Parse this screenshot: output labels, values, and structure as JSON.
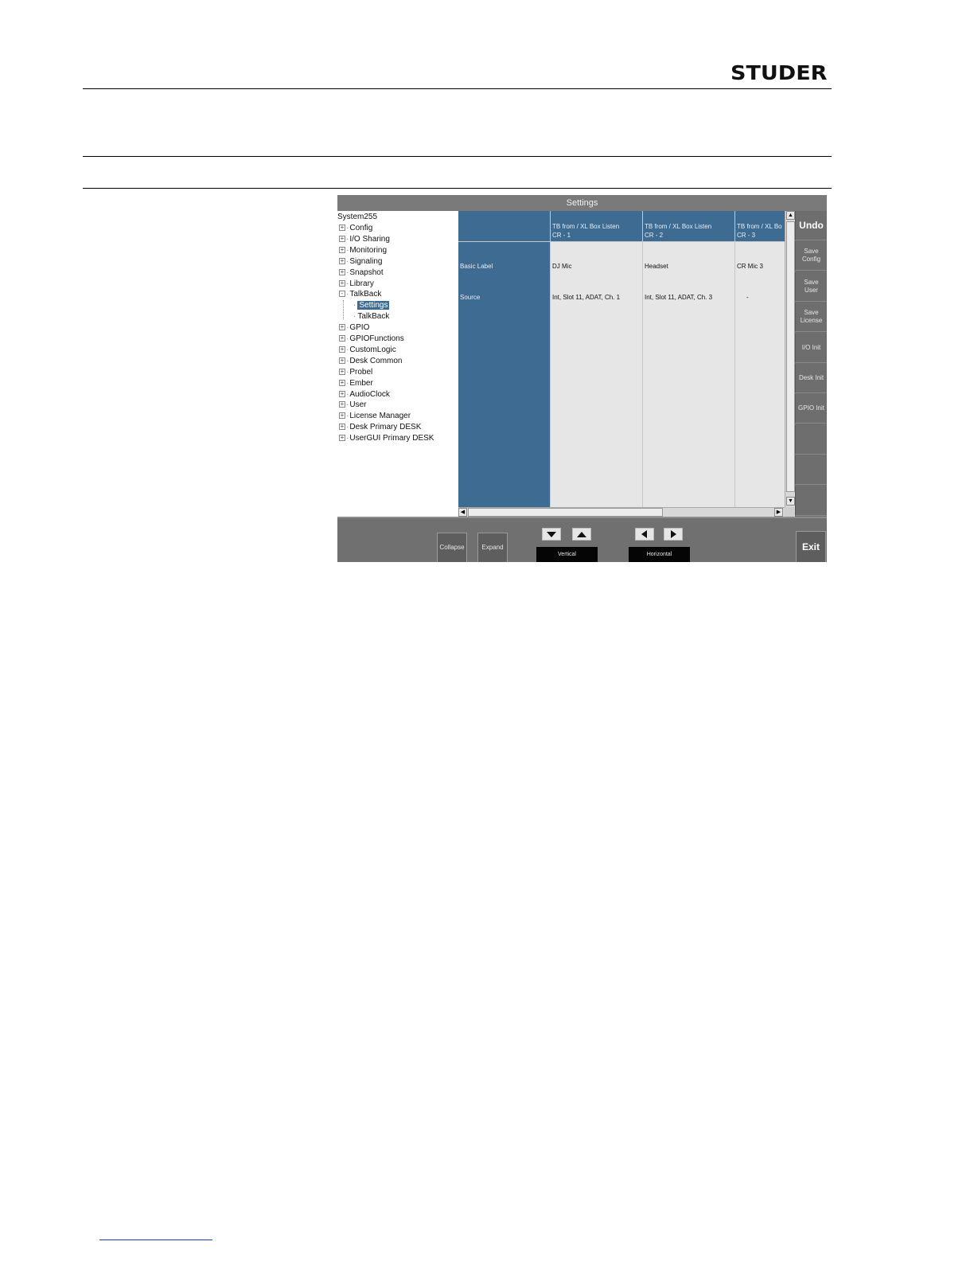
{
  "header": {
    "brand": "STUDER"
  },
  "window": {
    "title": "Settings",
    "tree": {
      "root": "System255",
      "items": [
        {
          "label": "Config",
          "expander": "+"
        },
        {
          "label": "I/O Sharing",
          "expander": "+"
        },
        {
          "label": "Monitoring",
          "expander": "+"
        },
        {
          "label": "Signaling",
          "expander": "+"
        },
        {
          "label": "Snapshot",
          "expander": "+"
        },
        {
          "label": "Library",
          "expander": "+"
        },
        {
          "label": "TalkBack",
          "expander": "-"
        },
        {
          "label": "Settings",
          "child": true,
          "selected": true
        },
        {
          "label": "TalkBack",
          "child": true
        },
        {
          "label": "GPIO",
          "expander": "+"
        },
        {
          "label": "GPIOFunctions",
          "expander": "+"
        },
        {
          "label": "CustomLogic",
          "expander": "+"
        },
        {
          "label": "Desk Common",
          "expander": "+"
        },
        {
          "label": "Probel",
          "expander": "+"
        },
        {
          "label": "Ember",
          "expander": "+"
        },
        {
          "label": "AudioClock",
          "expander": "+"
        },
        {
          "label": "User",
          "expander": "+"
        },
        {
          "label": "License Manager",
          "expander": "+"
        },
        {
          "label": "Desk Primary DESK",
          "expander": "+"
        },
        {
          "label": "UserGUI Primary DESK",
          "expander": "+"
        }
      ]
    },
    "grid": {
      "columns": [
        {
          "line1": "TB from / XL Box Listen",
          "line2": "CR - 1"
        },
        {
          "line1": "TB from / XL Box Listen",
          "line2": "CR - 2"
        },
        {
          "line1": "TB from / XL Bo",
          "line2": "CR - 3"
        }
      ],
      "rows": [
        {
          "label": "Basic Label",
          "values": [
            "DJ Mic",
            "Headset",
            "CR Mic 3"
          ]
        },
        {
          "label": "Source",
          "values": [
            "Int, Slot 11, ADAT, Ch. 1",
            "Int, Slot 11, ADAT, Ch. 3",
            "-"
          ]
        }
      ]
    },
    "sidebar": [
      "Undo",
      "Save Config",
      "Save User",
      "Save License",
      "I/O Init",
      "Desk Init",
      "GPIO Init"
    ],
    "bottom": {
      "collapse": "Collapse",
      "expand": "Expand",
      "vertical": "Vertical",
      "horizontal": "Horizontal",
      "exit": "Exit"
    }
  }
}
